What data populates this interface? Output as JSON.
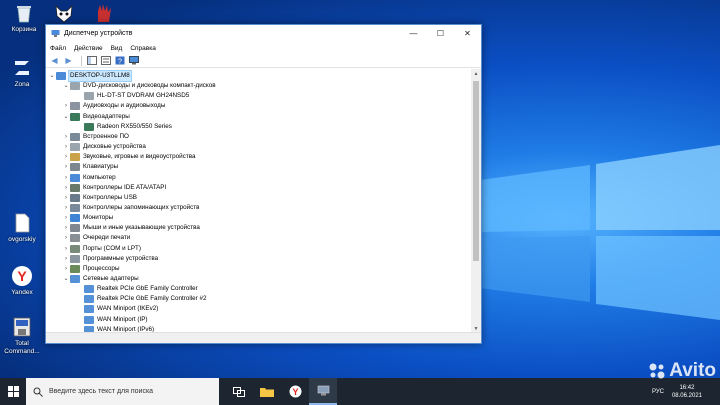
{
  "desktop": {
    "icons": [
      {
        "label": "Корзина",
        "icon": "recycle-bin-icon"
      },
      {
        "label": "Zona",
        "icon": "zona-icon"
      },
      {
        "label": "ovgorskiy",
        "icon": "file-icon"
      },
      {
        "label": "Yandex",
        "icon": "yandex-icon"
      },
      {
        "label": "Total Command...",
        "icon": "total-commander-icon"
      }
    ]
  },
  "window": {
    "title": "Диспетчер устройств",
    "menu": [
      "Файл",
      "Действие",
      "Вид",
      "Справка"
    ],
    "tree": [
      {
        "label": "DESKTOP-U3TLLM8",
        "level": 0,
        "expanded": true,
        "icon": "computer-icon",
        "selected": true
      },
      {
        "label": "DVD-дисководы и дисководы компакт-дисков",
        "level": 1,
        "expanded": true,
        "icon": "dvd-icon"
      },
      {
        "label": "HL-DT-ST DVDRAM GH24NSD5",
        "level": 2,
        "icon": "dvd-icon"
      },
      {
        "label": "Аудиовходы и аудиовыходы",
        "level": 1,
        "expanded": false,
        "icon": "audio-icon"
      },
      {
        "label": "Видеоадаптеры",
        "level": 1,
        "expanded": true,
        "icon": "display-adapter-icon"
      },
      {
        "label": "Radeon RX550/550 Series",
        "level": 2,
        "icon": "display-adapter-icon"
      },
      {
        "label": "Встроенное ПО",
        "level": 1,
        "expanded": false,
        "icon": "firmware-icon"
      },
      {
        "label": "Дисковые устройства",
        "level": 1,
        "expanded": false,
        "icon": "disk-icon"
      },
      {
        "label": "Звуковые, игровые и видеоустройства",
        "level": 1,
        "expanded": false,
        "icon": "sound-icon"
      },
      {
        "label": "Клавиатуры",
        "level": 1,
        "expanded": false,
        "icon": "keyboard-icon"
      },
      {
        "label": "Компьютер",
        "level": 1,
        "expanded": false,
        "icon": "computer-icon"
      },
      {
        "label": "Контроллеры IDE ATA/ATAPI",
        "level": 1,
        "expanded": false,
        "icon": "ide-icon"
      },
      {
        "label": "Контроллеры USB",
        "level": 1,
        "expanded": false,
        "icon": "usb-icon"
      },
      {
        "label": "Контроллеры запоминающих устройств",
        "level": 1,
        "expanded": false,
        "icon": "storage-icon"
      },
      {
        "label": "Мониторы",
        "level": 1,
        "expanded": false,
        "icon": "monitor-icon"
      },
      {
        "label": "Мыши и иные указывающие устройства",
        "level": 1,
        "expanded": false,
        "icon": "mouse-icon"
      },
      {
        "label": "Очереди печати",
        "level": 1,
        "expanded": false,
        "icon": "printer-icon"
      },
      {
        "label": "Порты (COM и LPT)",
        "level": 1,
        "expanded": false,
        "icon": "port-icon"
      },
      {
        "label": "Программные устройства",
        "level": 1,
        "expanded": false,
        "icon": "software-device-icon"
      },
      {
        "label": "Процессоры",
        "level": 1,
        "expanded": false,
        "icon": "processor-icon"
      },
      {
        "label": "Сетевые адаптеры",
        "level": 1,
        "expanded": true,
        "icon": "network-icon"
      },
      {
        "label": "Realtek PCIe GbE Family Controller",
        "level": 2,
        "icon": "network-icon"
      },
      {
        "label": "Realtek PCIe GbE Family Controller #2",
        "level": 2,
        "icon": "network-icon"
      },
      {
        "label": "WAN Miniport (IKEv2)",
        "level": 2,
        "icon": "network-icon"
      },
      {
        "label": "WAN Miniport (IP)",
        "level": 2,
        "icon": "network-icon"
      },
      {
        "label": "WAN Miniport (IPv6)",
        "level": 2,
        "icon": "network-icon"
      }
    ]
  },
  "taskbar": {
    "search_placeholder": "Введите здесь текст для поиска",
    "lang": "РУС",
    "time": "16:42",
    "date": "08.06.2021"
  },
  "watermark": "Avito"
}
